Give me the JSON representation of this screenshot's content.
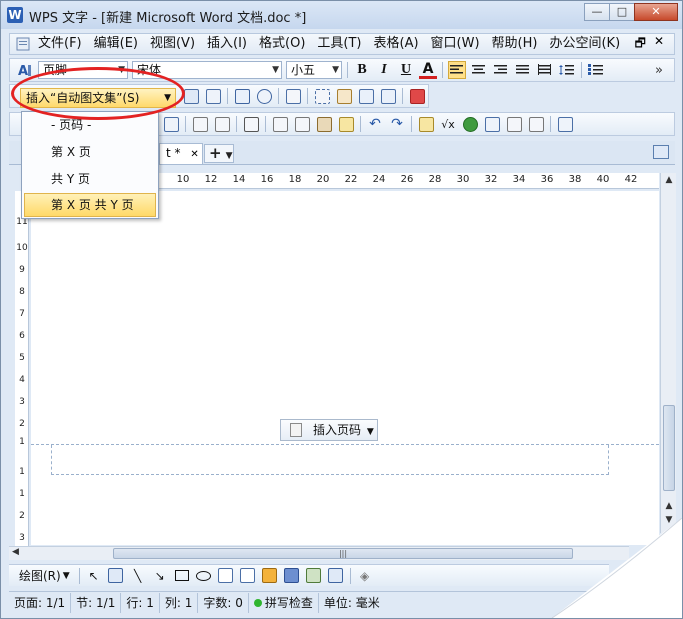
{
  "titlebar": {
    "app_icon": "W",
    "title": "WPS 文字 - [新建 Microsoft Word 文档.doc *]",
    "minimize": "—",
    "maximize": "□",
    "close": "✕"
  },
  "menubar": {
    "items": [
      "文件(F)",
      "编辑(E)",
      "视图(V)",
      "插入(I)",
      "格式(O)",
      "工具(T)",
      "表格(A)",
      "窗口(W)",
      "帮助(H)",
      "办公空间(K)"
    ],
    "restore": "🗗",
    "close": "✕"
  },
  "format_toolbar": {
    "style_value": "页脚",
    "font_value": "宋体",
    "size_value": "小五",
    "bold": "B",
    "italic": "I",
    "underline": "U",
    "font_color": "A",
    "more": "»"
  },
  "header_footer_toolbar": {
    "autotext_label": "插入“自动图文集”(S)"
  },
  "autotext_menu": {
    "items": [
      "- 页码 -",
      "第 X 页",
      "共 Y 页",
      "第 X 页 共 Y 页"
    ],
    "highlighted_index": 3
  },
  "tabs": {
    "doc_tab_label": "t *",
    "doc_tab_close": "✕",
    "add_tab": "+"
  },
  "ruler": {
    "h_labels": [
      "10",
      "12",
      "14",
      "16",
      "18",
      "20",
      "22",
      "24",
      "26",
      "28",
      "30",
      "32",
      "34",
      "36",
      "38",
      "40",
      "42"
    ],
    "v_labels": [
      "11",
      "10",
      "9",
      "8",
      "7",
      "6",
      "5",
      "4",
      "3",
      "2",
      "1",
      "1",
      "1",
      "2",
      "3"
    ]
  },
  "document": {
    "insert_page_number_label": "插入页码"
  },
  "drawbar": {
    "draw_label": "绘图(R)"
  },
  "statusbar": {
    "page": "页面: 1/1",
    "section": "节: 1/1",
    "line": "行: 1",
    "column": "列: 1",
    "word_count": "字数: 0",
    "spell_check": "拼写检查",
    "unit": "单位: 毫米"
  }
}
